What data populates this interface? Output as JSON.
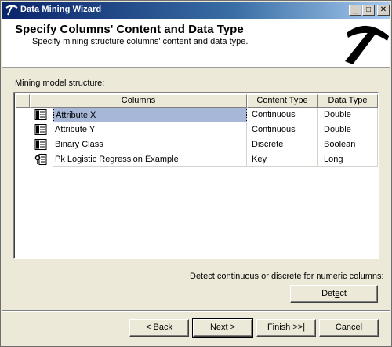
{
  "window": {
    "title": "Data Mining Wizard",
    "caption_buttons": {
      "minimize": "_",
      "maximize": "□",
      "close": "✕"
    }
  },
  "header": {
    "title": "Specify Columns' Content and Data Type",
    "subtitle": "Specify mining structure columns' content and data type."
  },
  "main": {
    "structure_label": "Mining model structure:",
    "columns": [
      "Columns",
      "Content Type",
      "Data Type"
    ],
    "rows": [
      {
        "name": "Attribute X",
        "content_type": "Continuous",
        "data_type": "Double",
        "icon": "column-icon",
        "selected": true
      },
      {
        "name": "Attribute Y",
        "content_type": "Continuous",
        "data_type": "Double",
        "icon": "column-icon",
        "selected": false
      },
      {
        "name": "Binary Class",
        "content_type": "Discrete",
        "data_type": "Boolean",
        "icon": "column-icon",
        "selected": false
      },
      {
        "name": "Pk Logistic Regression Example",
        "content_type": "Key",
        "data_type": "Long",
        "icon": "key-column-icon",
        "selected": false
      }
    ],
    "detect_label": "Detect continuous or discrete for numeric columns:",
    "detect_button": {
      "pre": "Det",
      "accel": "e",
      "post": "ct"
    }
  },
  "footer": {
    "back": {
      "pre": "< ",
      "accel": "B",
      "post": "ack"
    },
    "next": {
      "pre": "",
      "accel": "N",
      "post": "ext >"
    },
    "finish": {
      "pre": "",
      "accel": "F",
      "post": "inish >>|"
    },
    "cancel": "Cancel"
  },
  "colors": {
    "titlebar_start": "#0a246a",
    "selection": "#a6b7d8",
    "face": "#ece9d8"
  }
}
